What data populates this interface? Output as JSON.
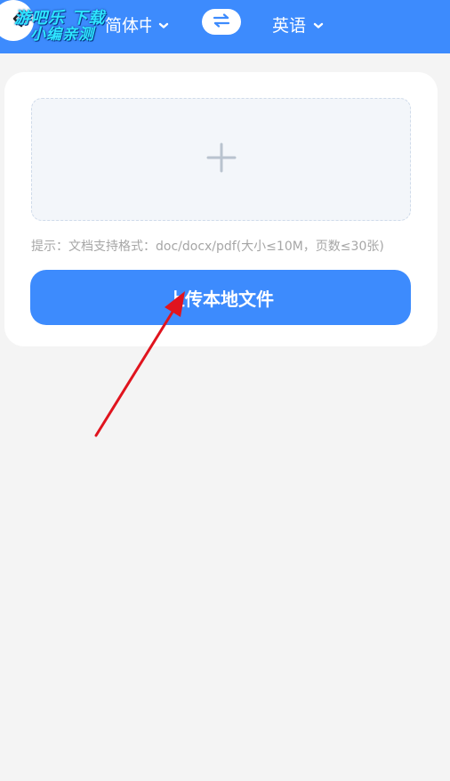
{
  "header": {
    "source_language": "简体中...",
    "target_language": "英语",
    "back_icon": "chevron-left-icon",
    "swap_icon": "swap-arrows-icon",
    "dropdown_icon": "chevron-down-icon",
    "background_color": "#3d8bfd"
  },
  "watermark": {
    "line1": "游吧乐 下载",
    "line2": "小编亲测"
  },
  "upload_card": {
    "add_icon": "plus-icon",
    "hint": "提示：文档支持格式：doc/docx/pdf(大小≤10M，页数≤30张)",
    "upload_button_label": "上传本地文件",
    "accent_color": "#3d8bfd"
  },
  "annotation": {
    "arrow_color": "#e0141e"
  }
}
